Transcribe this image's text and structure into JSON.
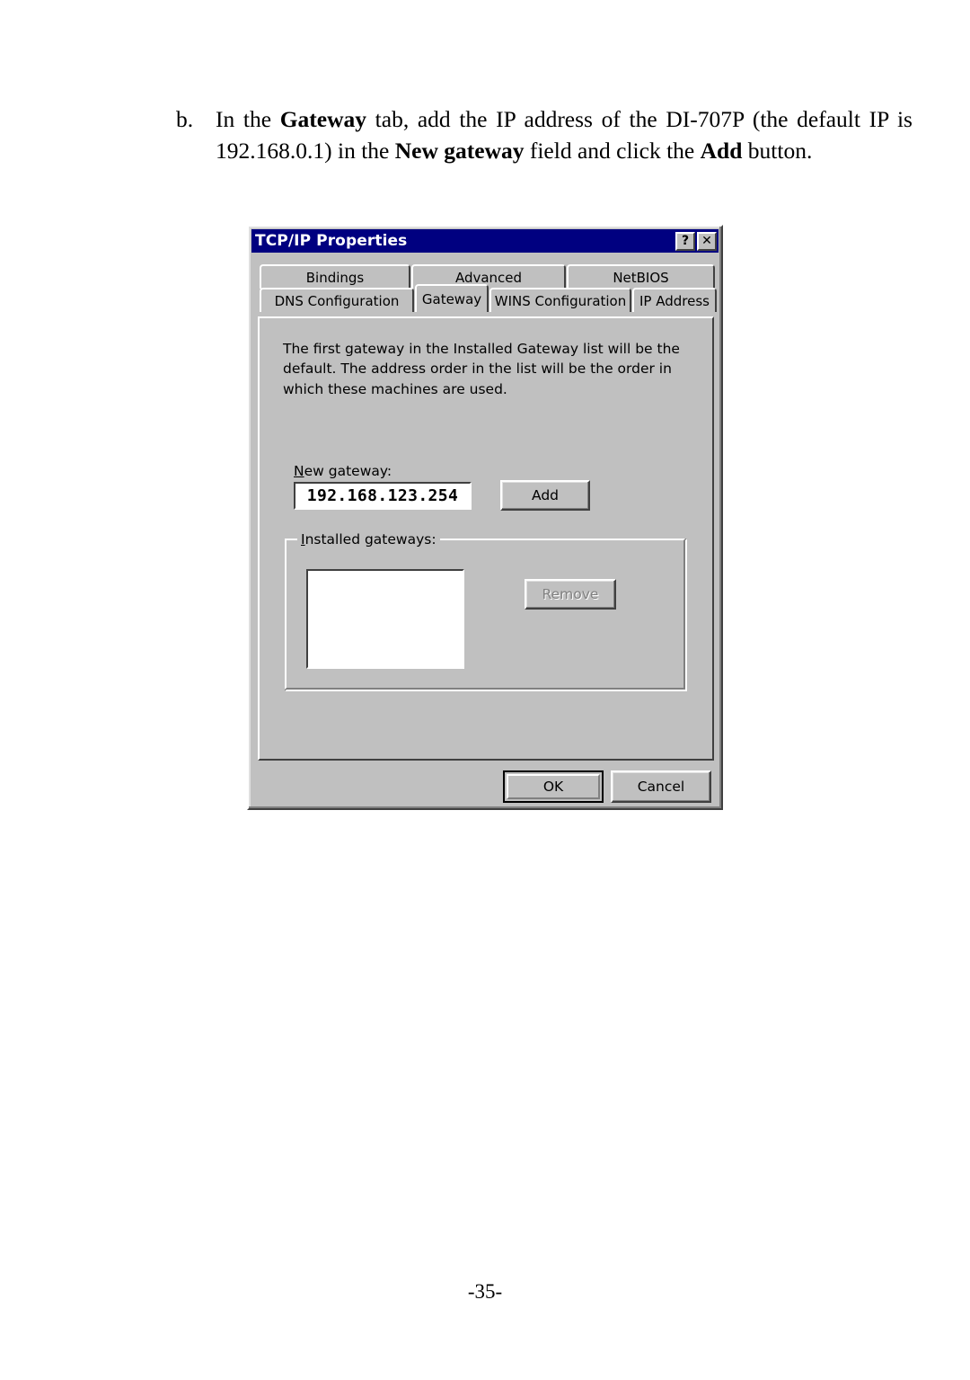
{
  "document": {
    "step_marker": "b.",
    "step_text_parts": [
      {
        "t": "In the ",
        "b": false
      },
      {
        "t": "Gateway",
        "b": true
      },
      {
        "t": " tab, add the IP address of the DI-707P (the default IP is 192.168.0.1) in the ",
        "b": false
      },
      {
        "t": "New gateway",
        "b": true
      },
      {
        "t": " field and click the ",
        "b": false
      },
      {
        "t": "Add",
        "b": true
      },
      {
        "t": " button.",
        "b": false
      }
    ],
    "page_number": "-35-"
  },
  "dialog": {
    "title": "TCP/IP Properties",
    "titlebar_buttons": [
      {
        "name": "help-button",
        "label": "?"
      },
      {
        "name": "close-button",
        "label": "✕"
      }
    ],
    "tabs_row1": [
      {
        "label": "Bindings",
        "selected": false
      },
      {
        "label": "Advanced",
        "selected": false
      },
      {
        "label": "NetBIOS",
        "selected": false
      }
    ],
    "tabs_row2": [
      {
        "label": "DNS Configuration",
        "selected": false
      },
      {
        "label": "Gateway",
        "selected": true
      },
      {
        "label": "WINS Configuration",
        "selected": false
      },
      {
        "label": "IP Address",
        "selected": false
      }
    ],
    "panel": {
      "description": "The first gateway in the Installed Gateway list will be the default. The address order in the list will be the order in which these machines are used.",
      "new_gateway_label": "New gateway:",
      "new_gateway_value": "192.168.123.254",
      "add_button": "Add",
      "installed_gateways_label": "Installed gateways:",
      "installed_gateways_items": [],
      "remove_button": "Remove",
      "remove_button_enabled": false
    },
    "ok_button": "OK",
    "cancel_button": "Cancel",
    "colors": {
      "titlebar": "#000080",
      "face": "#c0c0c0",
      "field": "#ffffff",
      "shadow": "#808080",
      "dark": "#404040"
    }
  }
}
